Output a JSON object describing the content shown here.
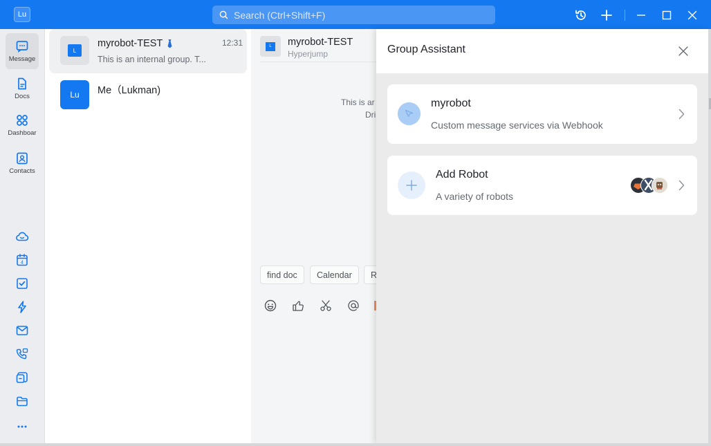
{
  "window": {
    "avatar_text": "Lu",
    "search_placeholder": "Search (Ctrl+Shift+F)"
  },
  "nav": {
    "items": [
      {
        "label": "Message",
        "icon": "message-icon"
      },
      {
        "label": "Docs",
        "icon": "docs-icon"
      },
      {
        "label": "Dashboar",
        "icon": "dashboard-icon"
      },
      {
        "label": "Contacts",
        "icon": "contacts-icon"
      }
    ],
    "tools": [
      "cloud-icon",
      "calendar-icon",
      "task-icon",
      "lightning-icon",
      "mail-icon",
      "phone-icon",
      "minutes-icon",
      "folder-icon",
      "more-icon"
    ],
    "calendar_day": "4"
  },
  "chats": [
    {
      "name": "myrobot-TEST",
      "avatar": "L",
      "time": "12:31",
      "preview": "This is an internal group. T..."
    },
    {
      "name": "Me（Lukman)",
      "avatar": "Lu",
      "time": "",
      "preview": ""
    }
  ],
  "conversation": {
    "avatar": "L",
    "title": "myrobot-TEST",
    "subtitle": "Hyperjump",
    "message_line1": "This is ar",
    "message_line2": "Dri",
    "quick_actions": [
      "find doc",
      "Calendar",
      "R"
    ]
  },
  "panel": {
    "title": "Group Assistant",
    "cards": [
      {
        "title": "myrobot",
        "subtitle": "Custom message services via Webhook"
      },
      {
        "title": "Add Robot",
        "subtitle": "A variety of robots"
      }
    ]
  },
  "colors": {
    "accent": "#1478f0",
    "nav_bg": "#ebedf0",
    "panel_bg": "#ebebec"
  }
}
